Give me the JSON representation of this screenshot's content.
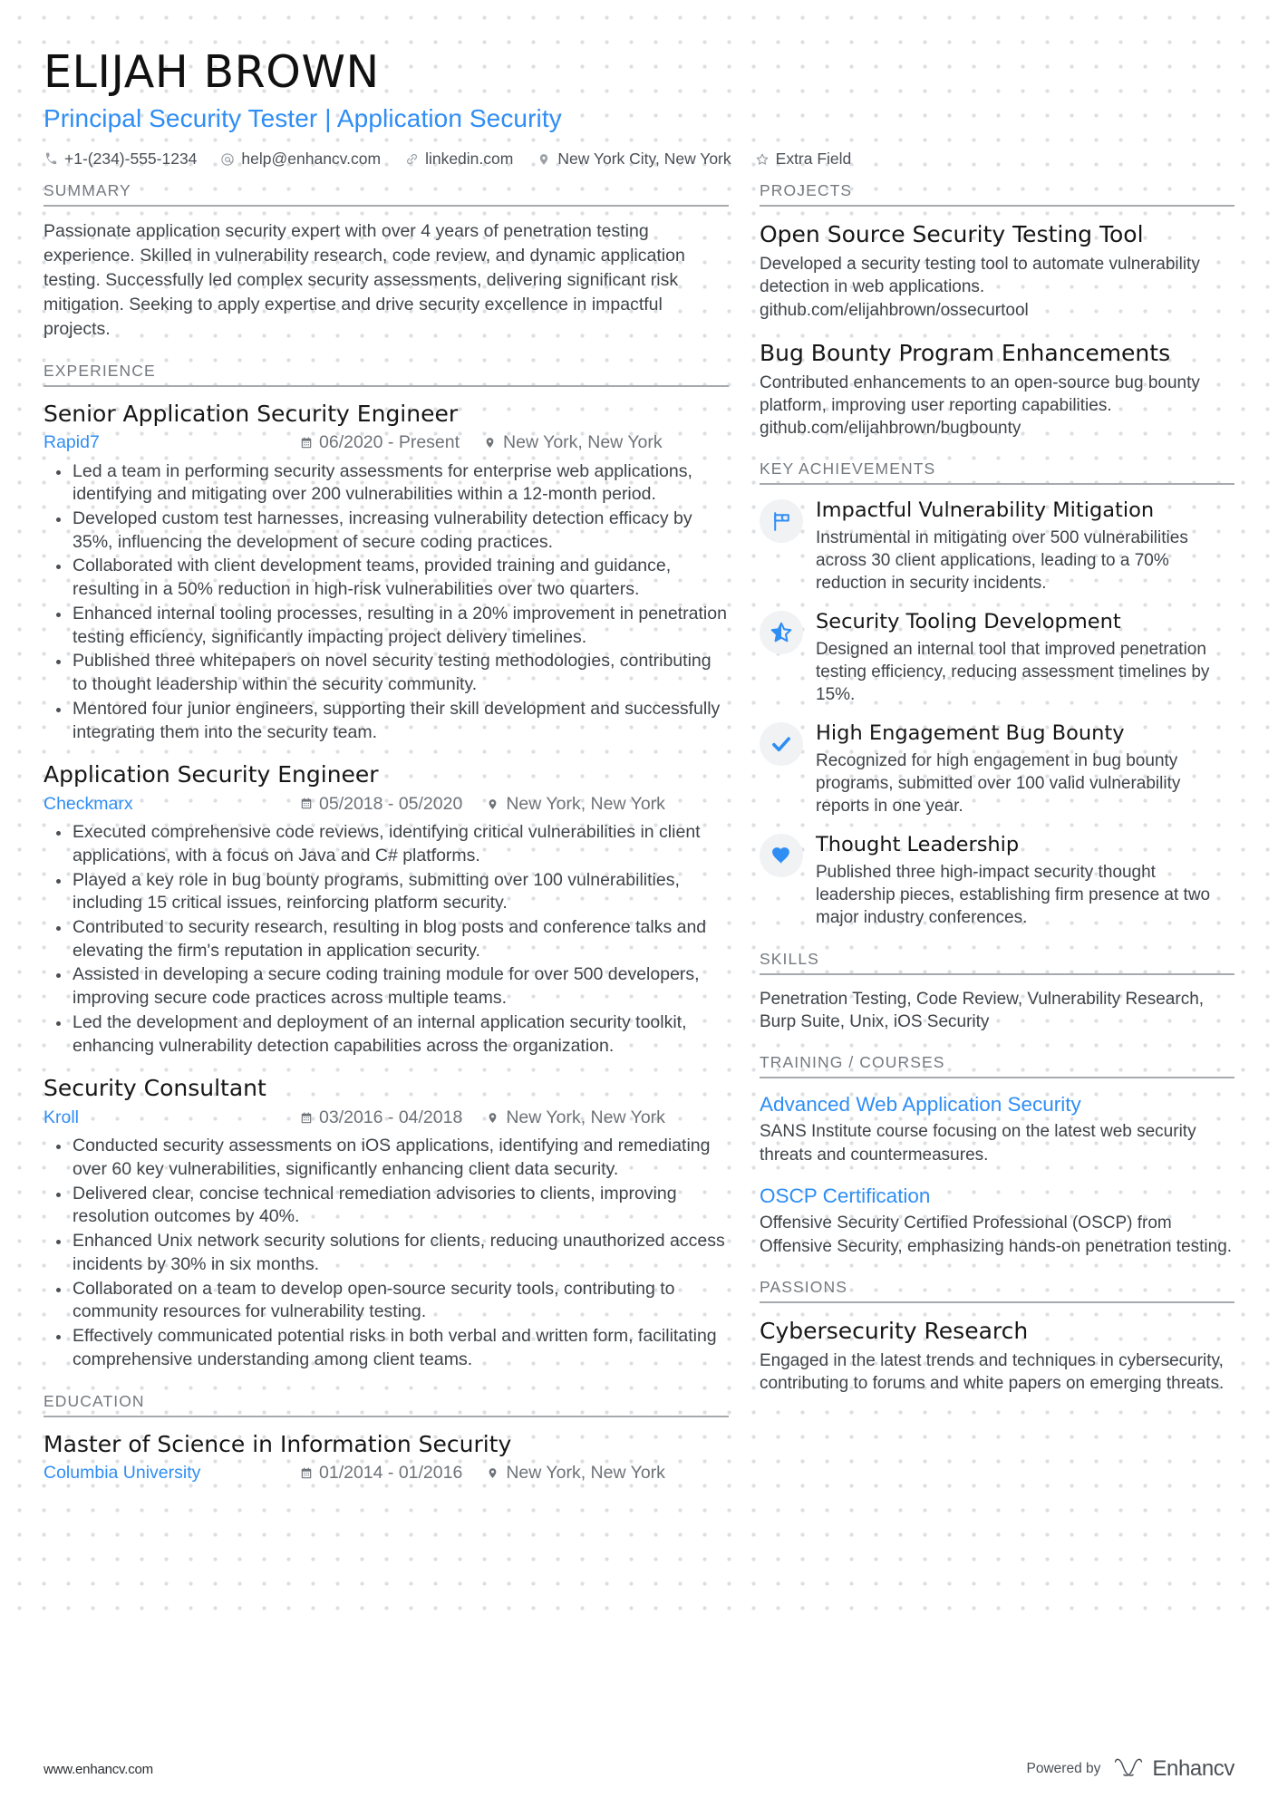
{
  "header": {
    "name": "ELIJAH BROWN",
    "title": "Principal Security Tester | Application Security",
    "accent_color": "#2f8ef4",
    "contacts": [
      {
        "icon": "phone-icon",
        "text": "+1-(234)-555-1234"
      },
      {
        "icon": "email-icon",
        "text": "help@enhancv.com"
      },
      {
        "icon": "link-icon",
        "text": "linkedin.com"
      },
      {
        "icon": "location-pin-icon",
        "text": "New York City, New York"
      },
      {
        "icon": "star-outline-icon",
        "text": "Extra Field"
      }
    ]
  },
  "summary": {
    "heading": "SUMMARY",
    "text": "Passionate application security expert with over 4 years of penetration testing experience. Skilled in vulnerability research, code review, and dynamic application testing. Successfully led complex security assessments, delivering significant risk mitigation. Seeking to apply expertise and drive security excellence in impactful projects."
  },
  "experience": {
    "heading": "EXPERIENCE",
    "entries": [
      {
        "title": "Senior Application Security Engineer",
        "company": "Rapid7",
        "dates": "06/2020 - Present",
        "location": "New York, New York",
        "bullets": [
          "Led a team in performing security assessments for enterprise web applications, identifying and mitigating over 200 vulnerabilities within a 12-month period.",
          "Developed custom test harnesses, increasing vulnerability detection efficacy by 35%, influencing the development of secure coding practices.",
          "Collaborated with client development teams, provided training and guidance, resulting in a 50% reduction in high-risk vulnerabilities over two quarters.",
          "Enhanced internal tooling processes, resulting in a 20% improvement in penetration testing efficiency, significantly impacting project delivery timelines.",
          "Published three whitepapers on novel security testing methodologies, contributing to thought leadership within the security community.",
          "Mentored four junior engineers, supporting their skill development and successfully integrating them into the security team."
        ]
      },
      {
        "title": "Application Security Engineer",
        "company": "Checkmarx",
        "dates": "05/2018 - 05/2020",
        "location": "New York, New York",
        "bullets": [
          "Executed comprehensive code reviews, identifying critical vulnerabilities in client applications, with a focus on Java and C# platforms.",
          "Played a key role in bug bounty programs, submitting over 100 vulnerabilities, including 15 critical issues, reinforcing platform security.",
          "Contributed to security research, resulting in blog posts and conference talks and elevating the firm's reputation in application security.",
          "Assisted in developing a secure coding training module for over 500 developers, improving secure code practices across multiple teams.",
          "Led the development and deployment of an internal application security toolkit, enhancing vulnerability detection capabilities across the organization."
        ]
      },
      {
        "title": "Security Consultant",
        "company": "Kroll",
        "dates": "03/2016 - 04/2018",
        "location": "New York, New York",
        "bullets": [
          "Conducted security assessments on iOS applications, identifying and remediating over 60 key vulnerabilities, significantly enhancing client data security.",
          "Delivered clear, concise technical remediation advisories to clients, improving resolution outcomes by 40%.",
          "Enhanced Unix network security solutions for clients, reducing unauthorized access incidents by 30% in six months.",
          "Collaborated on a team to develop open-source security tools, contributing to community resources for vulnerability testing.",
          "Effectively communicated potential risks in both verbal and written form, facilitating comprehensive understanding among client teams."
        ]
      }
    ]
  },
  "education": {
    "heading": "EDUCATION",
    "entries": [
      {
        "title": "Master of Science in Information Security",
        "company": "Columbia University",
        "dates": "01/2014 - 01/2016",
        "location": "New York, New York"
      }
    ]
  },
  "projects": {
    "heading": "PROJECTS",
    "items": [
      {
        "title": "Open Source Security Testing Tool",
        "text": "Developed a security testing tool to automate vulnerability detection in web applications. github.com/elijahbrown/ossecurtool"
      },
      {
        "title": "Bug Bounty Program Enhancements",
        "text": "Contributed enhancements to an open-source bug bounty platform, improving user reporting capabilities. github.com/elijahbrown/bugbounty"
      }
    ]
  },
  "key_achievements": {
    "heading": "KEY ACHIEVEMENTS",
    "items": [
      {
        "icon": "flag-icon",
        "title": "Impactful Vulnerability Mitigation",
        "desc": "Instrumental in mitigating over 500 vulnerabilities across 30 client applications, leading to a 70% reduction in security incidents."
      },
      {
        "icon": "star-half-icon",
        "title": "Security Tooling Development",
        "desc": "Designed an internal tool that improved penetration testing efficiency, reducing assessment timelines by 15%."
      },
      {
        "icon": "check-icon",
        "title": "High Engagement Bug Bounty",
        "desc": "Recognized for high engagement in bug bounty programs, submitted over 100 valid vulnerability reports in one year."
      },
      {
        "icon": "heart-icon",
        "title": "Thought Leadership",
        "desc": "Published three high-impact security thought leadership pieces, establishing firm presence at two major industry conferences."
      }
    ]
  },
  "skills": {
    "heading": "SKILLS",
    "text": "Penetration Testing, Code Review, Vulnerability Research, Burp Suite, Unix, iOS Security"
  },
  "training": {
    "heading": "TRAINING / COURSES",
    "items": [
      {
        "title": "Advanced Web Application Security",
        "text": "SANS Institute course focusing on the latest web security threats and countermeasures."
      },
      {
        "title": "OSCP Certification",
        "text": "Offensive Security Certified Professional (OSCP) from Offensive Security, emphasizing hands-on penetration testing."
      }
    ]
  },
  "passions": {
    "heading": "PASSIONS",
    "items": [
      {
        "title": "Cybersecurity Research",
        "text": "Engaged in the latest trends and techniques in cybersecurity, contributing to forums and white papers on emerging threats."
      }
    ]
  },
  "footer": {
    "url": "www.enhancv.com",
    "powered_by": "Powered by",
    "brand": "Enhancv"
  }
}
